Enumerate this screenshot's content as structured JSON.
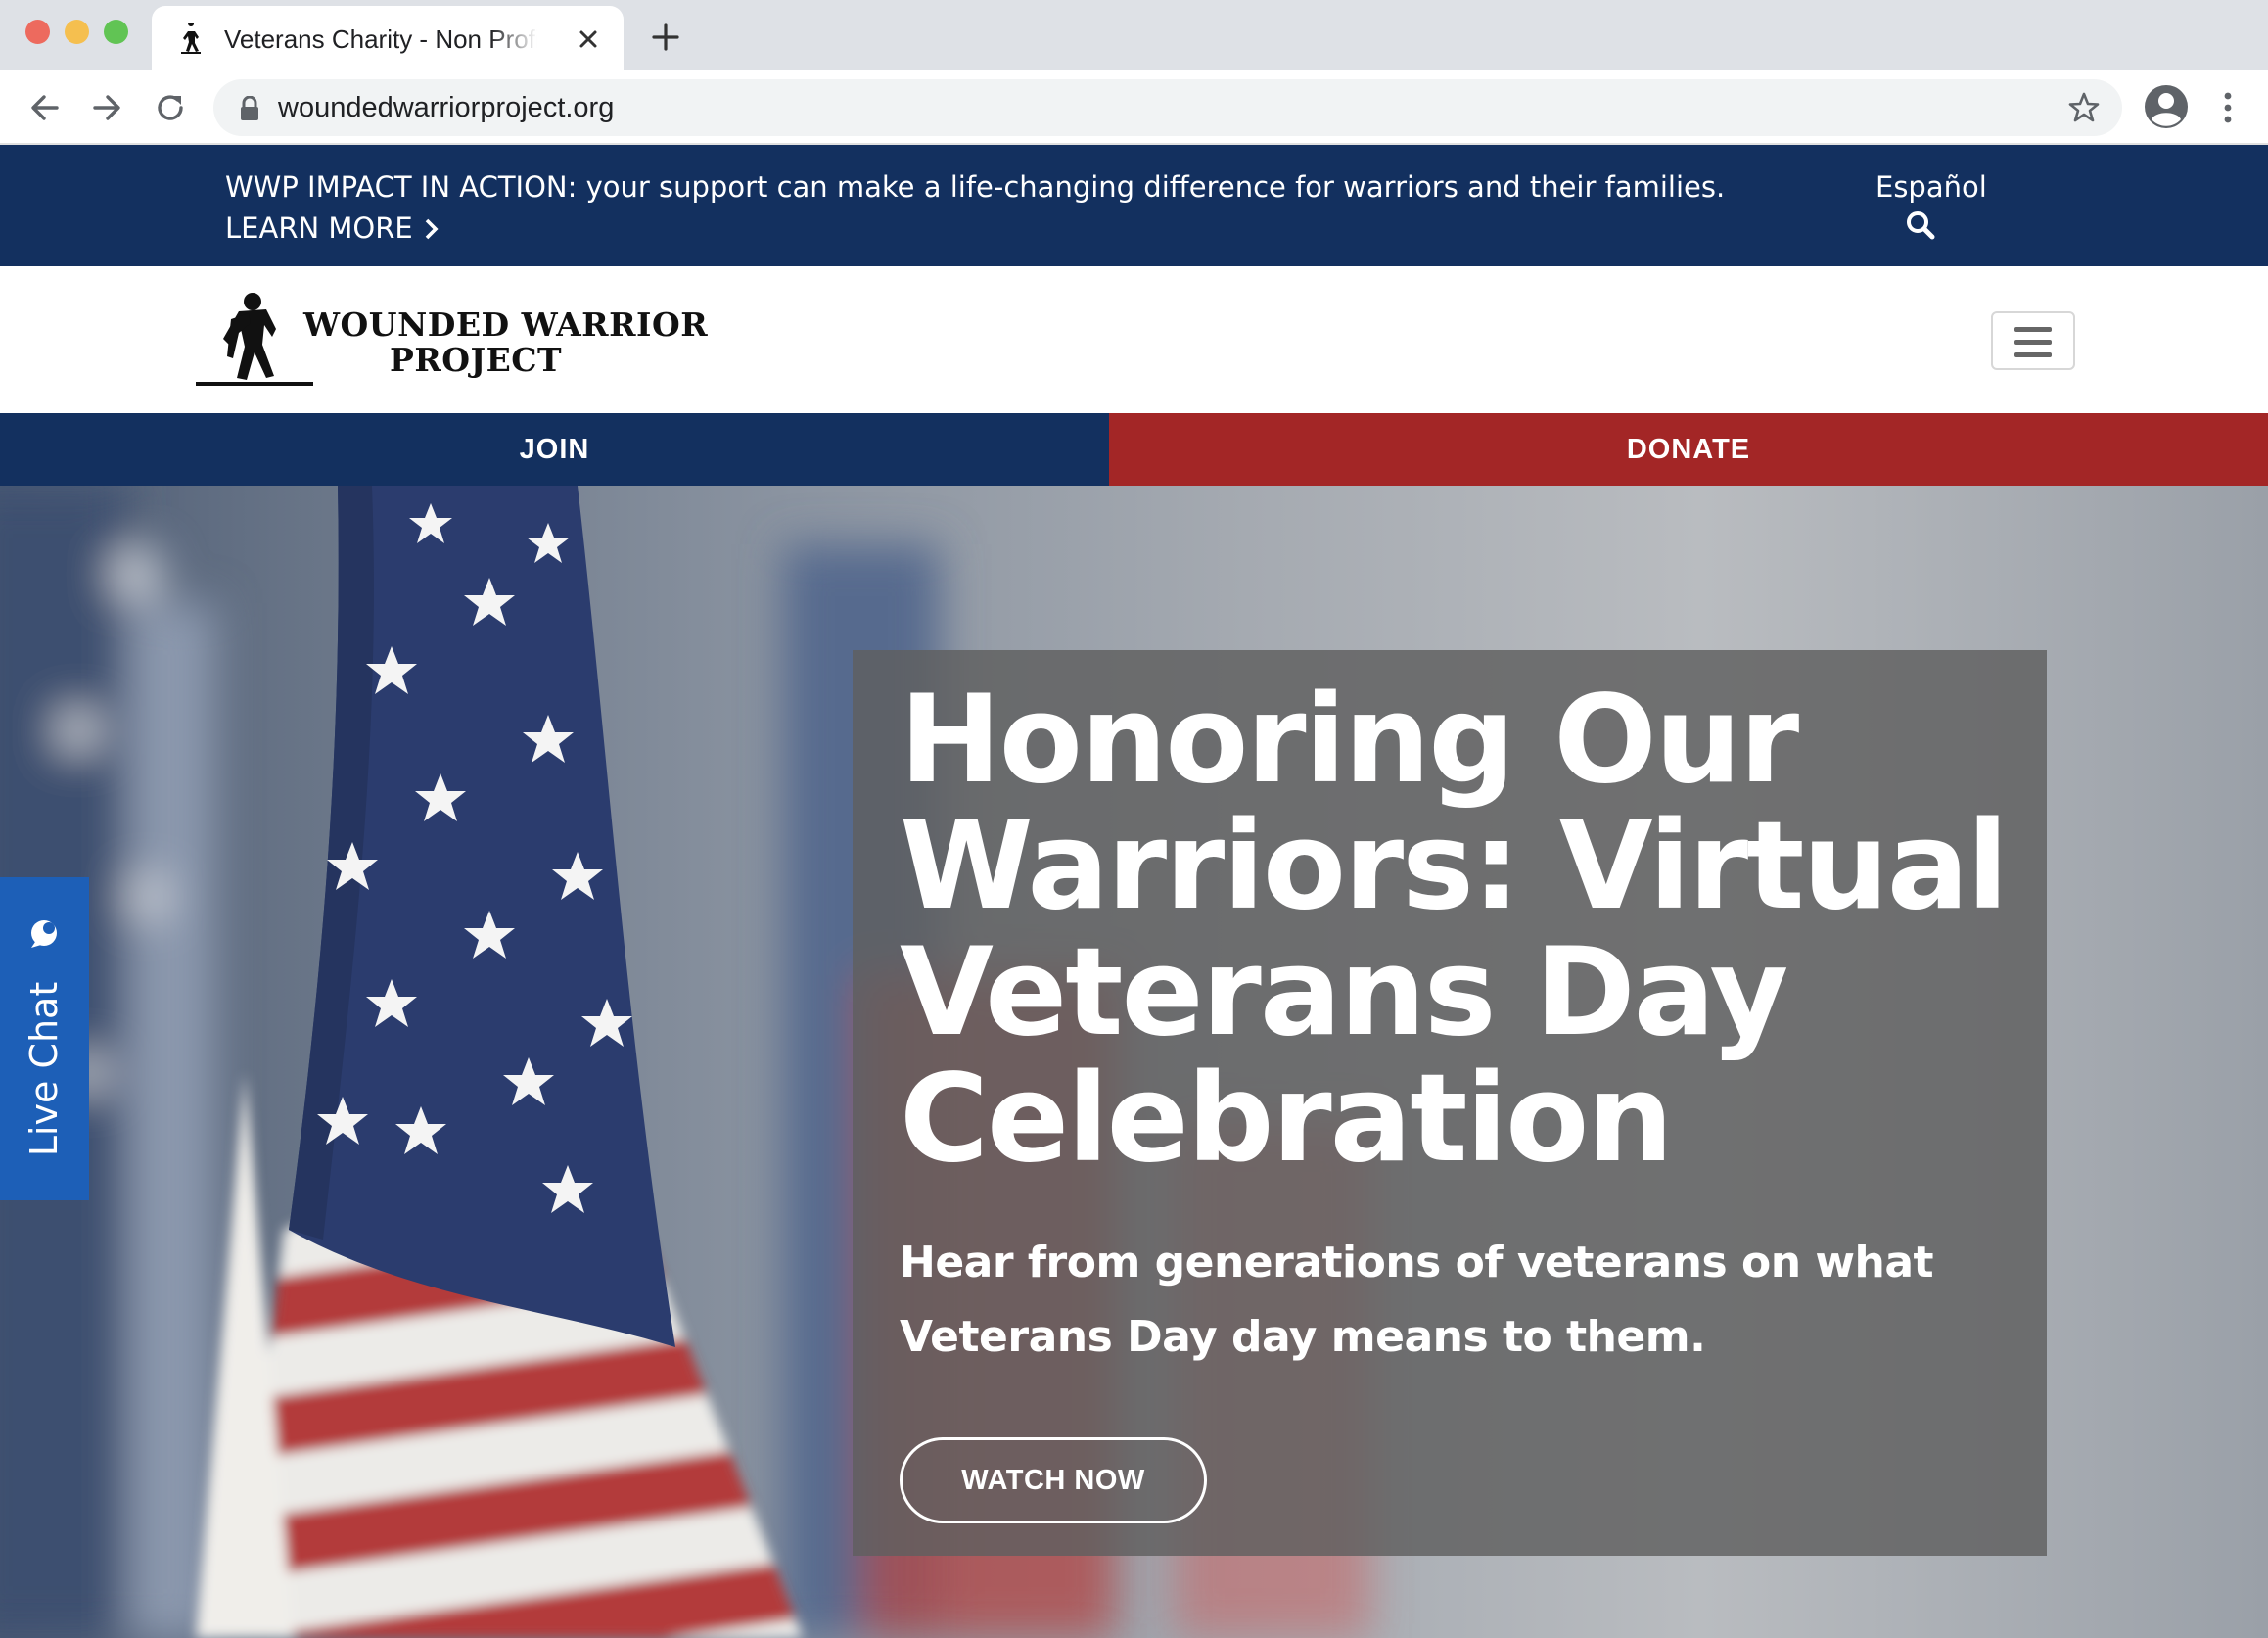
{
  "browser": {
    "tab_title": "Veterans Charity - Non Profit Organization",
    "url": "woundedwarriorproject.org",
    "icons": [
      "favicon-icon",
      "close-icon",
      "plus-icon",
      "back-icon",
      "forward-icon",
      "reload-icon",
      "lock-icon",
      "star-icon",
      "profile-icon",
      "more-menu-icon"
    ]
  },
  "announcement": {
    "text": "WWP IMPACT IN ACTION: your support can make a life-changing difference for warriors and their families.",
    "link_label": "LEARN MORE",
    "language_label": "Español"
  },
  "logo": {
    "line1": "WOUNDED WARRIOR",
    "line2": "PROJECT"
  },
  "cta": {
    "join_label": "JOIN",
    "donate_label": "DONATE"
  },
  "hero": {
    "title": "Honoring Our Warriors: Virtual Veterans Day Celebration",
    "subtitle": "Hear from generations of veterans on what Veterans Day day means to them.",
    "button_label": "WATCH NOW"
  },
  "live_chat": {
    "label": "Live Chat"
  },
  "colors": {
    "navy": "#13305f",
    "red": "#a32626",
    "chat_blue": "#1d5fb7"
  }
}
